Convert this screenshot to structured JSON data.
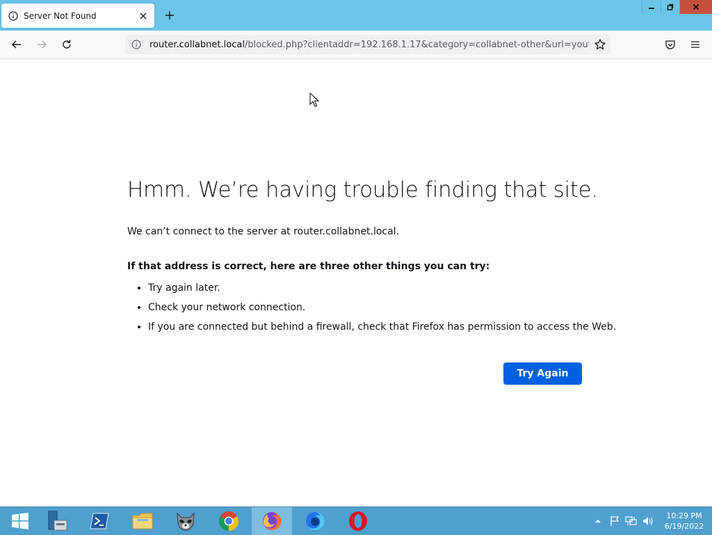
{
  "tab": {
    "title": "Server Not Found"
  },
  "addressbar": {
    "url_host": "router.collabnet.local",
    "url_rest": "/blocked.php?clientaddr=192.168.1.17&category=collabnet-other&url=youtube.co"
  },
  "page": {
    "title": "Hmm. We’re having trouble finding that site.",
    "description": "We can’t connect to the server at router.collabnet.local.",
    "suggestions_heading": "If that address is correct, here are three other things you can try:",
    "suggestions": [
      "Try again later.",
      "Check your network connection.",
      "If you are connected but behind a firewall, check that Firefox has permission to access the Web."
    ],
    "try_again_label": "Try Again"
  },
  "taskbar": {
    "apps": [
      "start-icon",
      "server-manager-icon",
      "powershell-icon",
      "file-explorer-icon",
      "raccoon-app-icon",
      "chrome-icon",
      "firefox-icon",
      "firefox-developer-icon",
      "opera-icon"
    ],
    "active_app": "firefox-icon"
  },
  "clock": {
    "time": "10:29 PM",
    "date": "6/19/2022"
  },
  "colors": {
    "accent": "#0061e0",
    "titlebar": "#6bc5e8",
    "taskbar": "#4f9fcf"
  }
}
